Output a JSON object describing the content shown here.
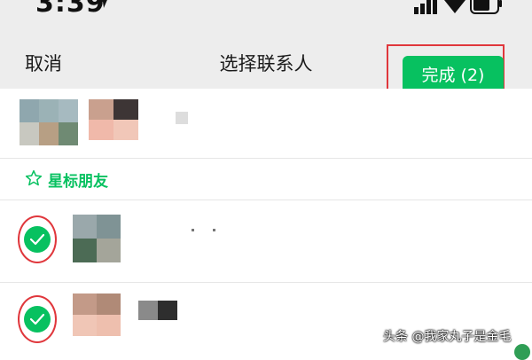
{
  "status_bar": {
    "time": "3:39"
  },
  "nav": {
    "cancel_label": "取消",
    "title": "选择联系人",
    "done_label": "完成 (2)"
  },
  "section": {
    "starred_label": "星标朋友"
  },
  "watermark": "头条 @我家丸子是金毛",
  "colors": {
    "accent": "#07c160",
    "highlight": "#e0373c",
    "nav_bg": "#ededed"
  }
}
